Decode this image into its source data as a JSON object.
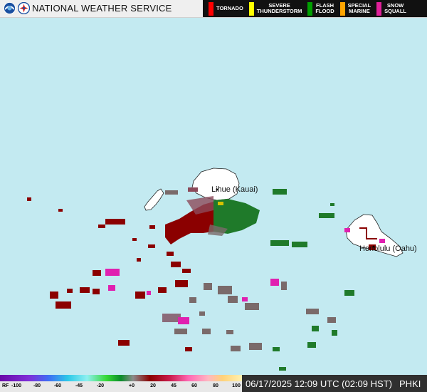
{
  "header": {
    "agency_title": "NATIONAL WEATHER SERVICE",
    "logos": [
      "noaa-logo",
      "nws-logo"
    ],
    "warning_legend": [
      {
        "label": "TORNADO",
        "color": "#ff0000"
      },
      {
        "label": "SEVERE\nTHUNDERSTORM",
        "color": "#ffff00"
      },
      {
        "label": "FLASH\nFLOOD",
        "color": "#00a000"
      },
      {
        "label": "SPECIAL\nMARINE",
        "color": "#ffa500"
      },
      {
        "label": "SNOW\nSQUALL",
        "color": "#e0209a"
      }
    ]
  },
  "map": {
    "background": "#c3eaf1",
    "land_color": "#ffffff",
    "cities": [
      {
        "label": "Lihue (Kauai)"
      },
      {
        "label": "Honolulu (Oahu)"
      }
    ]
  },
  "footer": {
    "scale_prefix": "RF",
    "ticks": [
      "-100",
      "-80",
      "-60",
      "-45",
      "-20",
      "+0",
      "20",
      "45",
      "60",
      "80",
      "100"
    ],
    "timestamp": "06/17/2025 12:09 UTC (02:09 HST)",
    "station": "PHKI"
  }
}
